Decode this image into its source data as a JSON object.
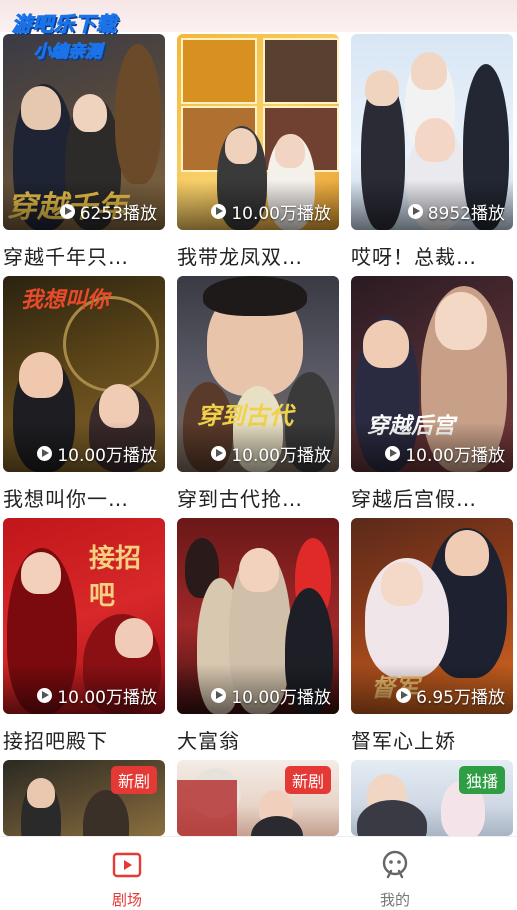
{
  "watermark": {
    "line1": "游吧乐下载",
    "line2": "小编亲测"
  },
  "colors": {
    "accent": "#e53935",
    "nav_inactive": "#777777",
    "badge_new": "#e53935",
    "badge_exclusive": "#2e9d43"
  },
  "cards": [
    {
      "title": "穿越千年只…",
      "plays": "6253播放"
    },
    {
      "title": "我带龙凤双…",
      "plays": "10.00万播放"
    },
    {
      "title": "哎呀！总裁…",
      "plays": "8952播放"
    },
    {
      "title": "我想叫你一…",
      "plays": "10.00万播放"
    },
    {
      "title": "穿到古代抢…",
      "plays": "10.00万播放"
    },
    {
      "title": "穿越后宫假…",
      "plays": "10.00万播放"
    },
    {
      "title": "接招吧殿下",
      "plays": "10.00万播放"
    },
    {
      "title": "大富翁",
      "plays": "10.00万播放"
    },
    {
      "title": "督军心上娇",
      "plays": "6.95万播放"
    }
  ],
  "partial_cards": [
    {
      "badge": "新剧",
      "badge_color": "#e53935"
    },
    {
      "badge": "新剧",
      "badge_color": "#e53935"
    },
    {
      "badge": "独播",
      "badge_color": "#2e9d43"
    }
  ],
  "nav": {
    "theater": {
      "label": "剧场",
      "icon": "play-screen-icon",
      "active": true
    },
    "mine": {
      "label": "我的",
      "icon": "user-face-icon",
      "active": false
    }
  }
}
